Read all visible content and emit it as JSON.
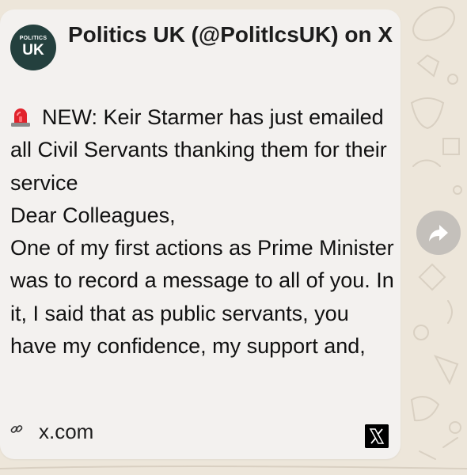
{
  "message": {
    "avatar": {
      "small_text": "POLITICS",
      "large_text": "UK"
    },
    "title": "Politics UK (@PolitlcsUK) on X",
    "body_lines": [
      "NEW: Keir Starmer has just emailed all Civil Servants thanking them for their service",
      "Dear Colleagues,",
      "One of my first actions as Prime Minister was to record a message to all of you. In it, I said that as public servants, you have my confidence, my support and,"
    ],
    "link": {
      "domain": "x.com",
      "icon": "link-icon",
      "brand_icon": "x-logo-icon"
    }
  },
  "actions": {
    "share_icon": "forward-share-icon"
  },
  "colors": {
    "card": "#f3f1ef",
    "wallpaper": "#ede6da",
    "avatar_bg": "#24403e",
    "share_button": "#c4c0bb"
  }
}
